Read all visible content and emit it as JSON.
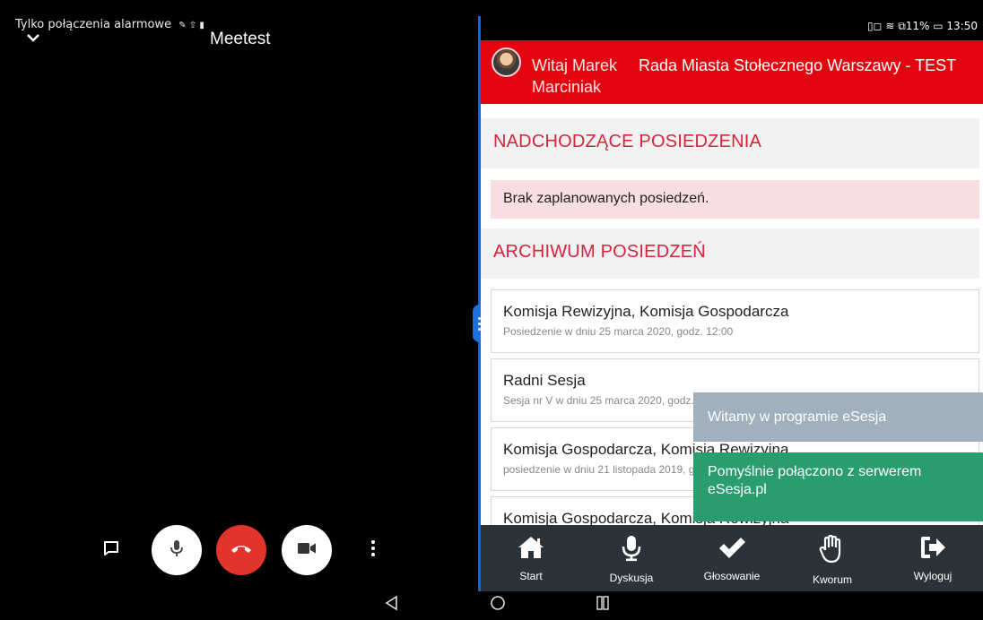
{
  "left": {
    "status_text": "Tylko połączenia alarmowe",
    "status_icons": "✎ ⇧ ▮",
    "app_title": "Meetest",
    "controls": [
      "chat-icon",
      "microphone-icon",
      "hangup-icon",
      "camera-icon",
      "more-vert-icon"
    ]
  },
  "right": {
    "status_bar": "▯◻ ≋ ⧉11% ▭ 13:50",
    "greeting": "Witaj Marek Marciniak",
    "council_title": "Rada Miasta Stołecznego Warszawy - TEST",
    "upcoming_heading": "NADCHODZĄCE POSIEDZENIA",
    "no_meetings": "Brak zaplanowanych posiedzeń.",
    "archive_heading": "ARCHIWUM POSIEDZEŃ",
    "meetings": [
      {
        "title": "Komisja Rewizyjna, Komisja Gospodarcza",
        "subtitle": "Posiedzenie w dniu 25 marca 2020, godz. 12:00"
      },
      {
        "title": "Radni Sesja",
        "subtitle": "Sesja nr V w dniu 25 marca 2020, godz. 1"
      },
      {
        "title": "Komisja Gospodarcza, Komisja Rewizyjna",
        "subtitle": "posiedzenie w dniu 21 listopada 2019, godz. 1"
      },
      {
        "title": "Komisja Gospodarcza, Komisja Rewizyjna",
        "subtitle": ""
      }
    ],
    "toasts": {
      "welcome": "Witamy w programie eSesja",
      "connected": "Pomyślnie połączono z serwerem eSesja.pl"
    },
    "nav": [
      {
        "label": "Start",
        "icon": "home-icon"
      },
      {
        "label": "Dyskusja",
        "icon": "microphone-icon"
      },
      {
        "label": "Głosowanie",
        "icon": "checkmark-icon"
      },
      {
        "label": "Kworum",
        "icon": "hand-icon"
      },
      {
        "label": "Wyloguj",
        "icon": "logout-icon"
      }
    ]
  },
  "colors": {
    "header_red": "#e3040f",
    "section_heading": "#d6243a",
    "hangup_red": "#e2342c",
    "toast_info": "#a0b0bd",
    "toast_success": "#2a9d6e",
    "bottom_nav": "#2c3338",
    "split_divider": "#1565d8"
  }
}
